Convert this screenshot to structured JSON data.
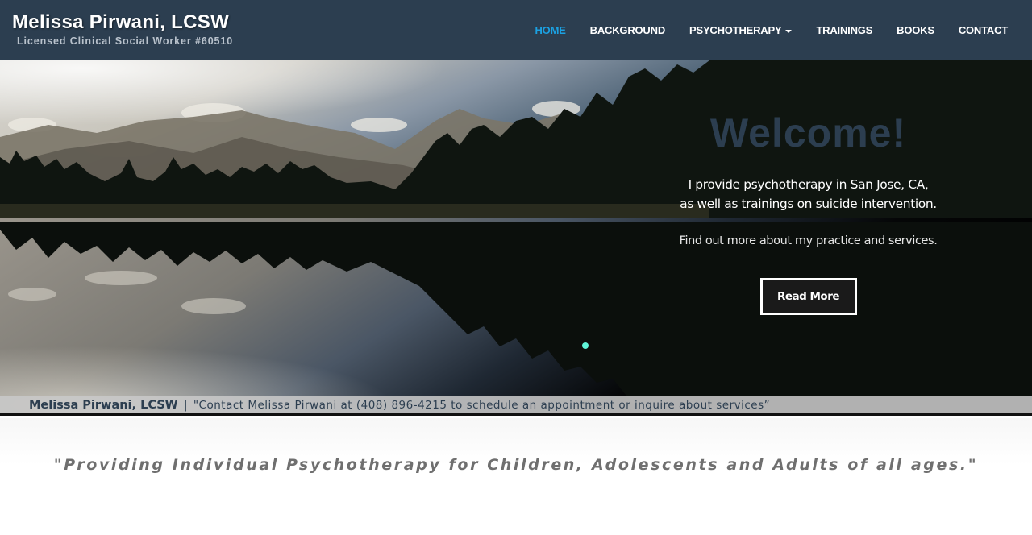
{
  "header": {
    "title": "Melissa Pirwani, LCSW",
    "subtitle": "Licensed Clinical Social Worker #60510",
    "nav": [
      {
        "label": "HOME",
        "active": true
      },
      {
        "label": "BACKGROUND",
        "active": false
      },
      {
        "label": "PSYCHOTHERAPY",
        "active": false,
        "dropdown": true
      },
      {
        "label": "TRAININGS",
        "active": false
      },
      {
        "label": "BOOKS",
        "active": false
      },
      {
        "label": "CONTACT",
        "active": false
      }
    ]
  },
  "hero": {
    "image": "mountain-lake-reflection",
    "welcome_title": "Welcome!",
    "line1": "I provide psychotherapy in San Jose, CA,",
    "line2": "as well as trainings on suicide intervention.",
    "find_out": "Find out more about my practice and services.",
    "read_more": "Read More"
  },
  "contact_strip": {
    "name": "Melissa Pirwani, LCSW",
    "separator": "|",
    "message": "\"Contact Melissa Pirwani at (408) 896-4215 to schedule an appointment or inquire about services”"
  },
  "tagline": "\"Providing Individual Psychotherapy for Children, Adolescents and Adults of all ages.\"",
  "colors": {
    "header_bg": "#2c3e50",
    "nav_active": "#1ba1e2",
    "welcome_title": "#2c3e50",
    "tagline": "#6f6f6f"
  }
}
